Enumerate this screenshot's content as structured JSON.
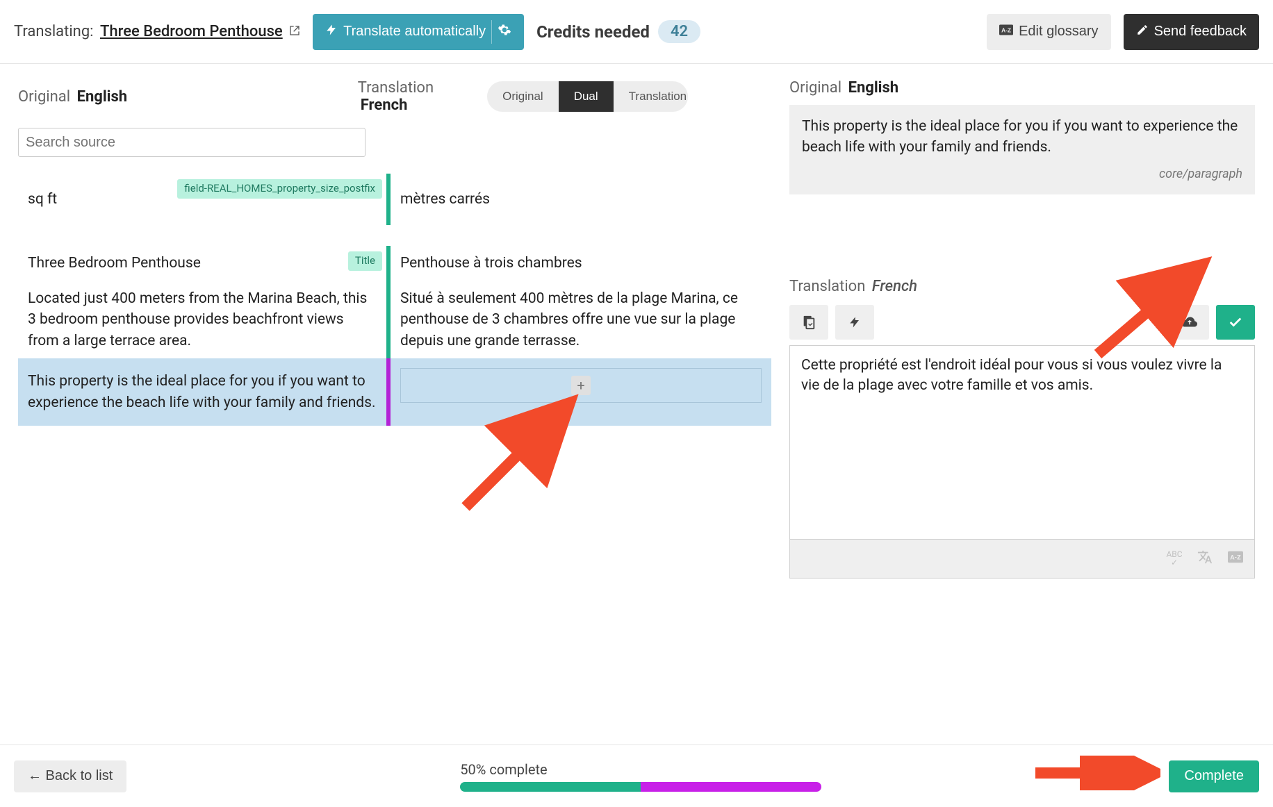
{
  "header": {
    "translating_label": "Translating:",
    "document_title": "Three Bedroom Penthouse",
    "auto_translate_label": "Translate automatically",
    "credits_label": "Credits needed",
    "credits_value": "42",
    "edit_glossary_label": "Edit glossary",
    "send_feedback_label": "Send feedback"
  },
  "left": {
    "original_label": "Original",
    "original_lang": "English",
    "translation_label": "Translation",
    "translation_lang": "French",
    "view_tabs": {
      "original": "Original",
      "dual": "Dual",
      "translation": "Translation"
    },
    "search_placeholder": "Search source"
  },
  "rows": [
    {
      "orig": "sq ft",
      "trans": "mètres carrés",
      "badge": "field-REAL_HOMES_property_size_postfix",
      "bar": "green"
    },
    {
      "orig": "Three Bedroom Penthouse",
      "trans": "Penthouse à trois chambres",
      "badge": "Title",
      "bar": "green"
    },
    {
      "orig": "Located just 400 meters from the Marina Beach, this 3 bedroom penthouse provides beachfront views from a large terrace area.",
      "trans": "Situé à seulement 400 mètres de la plage Marina, ce penthouse de 3 chambres offre une vue sur la plage depuis une grande terrasse.",
      "badge": "",
      "bar": "green"
    },
    {
      "orig": "This property is the ideal place for you if you want to experience the beach life with your family and friends.",
      "trans": "",
      "badge": "",
      "bar": "purple",
      "selected": true
    }
  ],
  "right": {
    "original_label": "Original",
    "original_lang": "English",
    "original_text": "This property is the ideal place for you if you want to experience the beach life with your family and friends.",
    "original_meta": "core/paragraph",
    "translation_label": "Translation",
    "translation_lang": "French",
    "translation_text": "Cette propriété est l'endroit idéal pour vous si vous voulez vivre la vie de la plage avec votre famille et vos amis."
  },
  "footer": {
    "back_label": "←  Back to list",
    "progress_label": "50% complete",
    "progress_green": 50,
    "progress_purple": 50,
    "complete_label": "Complete"
  }
}
